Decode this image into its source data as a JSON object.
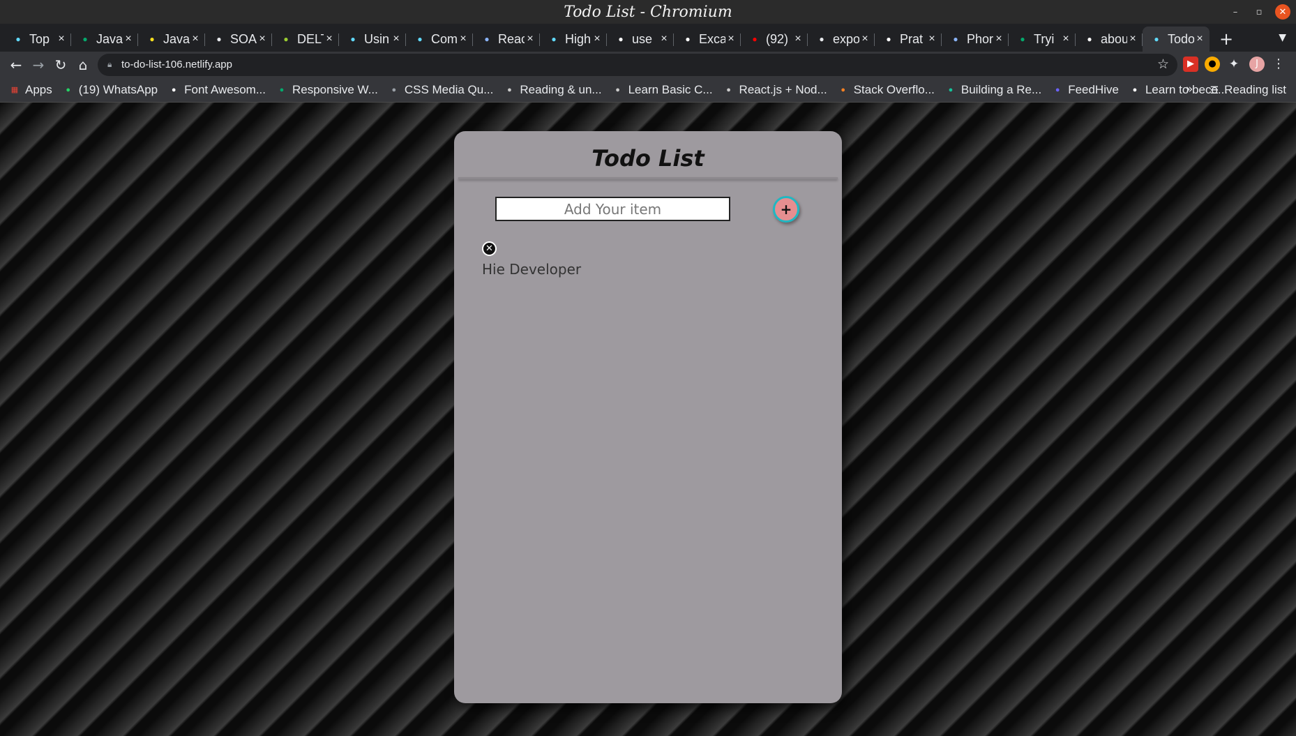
{
  "window": {
    "title": "Todo List - Chromium"
  },
  "tabs": [
    {
      "label": "Top",
      "icon": "react-icon",
      "color": "#61dafb"
    },
    {
      "label": "Java",
      "icon": "w3-icon",
      "color": "#04aa6d"
    },
    {
      "label": "Java",
      "icon": "js-icon",
      "color": "#f7df1e"
    },
    {
      "label": "SOA",
      "icon": "github-icon",
      "color": "#e8eaed"
    },
    {
      "label": "DELT",
      "icon": "refresh-icon",
      "color": "#9acd32"
    },
    {
      "label": "Usin",
      "icon": "react-icon",
      "color": "#61dafb"
    },
    {
      "label": "Com",
      "icon": "react-icon",
      "color": "#61dafb"
    },
    {
      "label": "Reac",
      "icon": "mountain-icon",
      "color": "#8ab4f8"
    },
    {
      "label": "High",
      "icon": "react-icon",
      "color": "#61dafb"
    },
    {
      "label": "use",
      "icon": "google-icon",
      "color": "#ffffff"
    },
    {
      "label": "Exca",
      "icon": "doc-icon",
      "color": "#ffffff"
    },
    {
      "label": "(92)",
      "icon": "youtube-icon",
      "color": "#ff0000"
    },
    {
      "label": "expo",
      "icon": "github-icon",
      "color": "#e8eaed"
    },
    {
      "label": "Prat",
      "icon": "bookmark-icon",
      "color": "#ffffff"
    },
    {
      "label": "Phor",
      "icon": "flag-icon",
      "color": "#8ab4f8"
    },
    {
      "label": "Tryi",
      "icon": "w3-icon",
      "color": "#04aa6d"
    },
    {
      "label": "abou",
      "icon": "globe-icon",
      "color": "#ffffff"
    },
    {
      "label": "Todo",
      "icon": "react-icon",
      "color": "#61dafb",
      "active": true
    }
  ],
  "toolbar": {
    "url": "to-do-list-106.netlify.app"
  },
  "bookmarks": [
    {
      "label": "Apps",
      "icon": "apps-grid-icon",
      "color": "#ea4335"
    },
    {
      "label": "(19) WhatsApp",
      "icon": "whatsapp-icon",
      "color": "#25d366"
    },
    {
      "label": "Font Awesom...",
      "icon": "flag-icon",
      "color": "#ffffff"
    },
    {
      "label": "Responsive W...",
      "icon": "w3-icon",
      "color": "#04aa6d"
    },
    {
      "label": "CSS Media Qu...",
      "icon": "github-icon",
      "color": "#9aa0a6"
    },
    {
      "label": "Reading & un...",
      "icon": "eye-icon",
      "color": "#cccccc"
    },
    {
      "label": "Learn Basic C...",
      "icon": "angular-icon",
      "color": "#cccccc"
    },
    {
      "label": "React.js + Nod...",
      "icon": "braces-icon",
      "color": "#cccccc"
    },
    {
      "label": "Stack Overflo...",
      "icon": "stackoverflow-icon",
      "color": "#f48024"
    },
    {
      "label": "Building a Re...",
      "icon": "grammarly-icon",
      "color": "#15c39a"
    },
    {
      "label": "FeedHive",
      "icon": "feedhive-icon",
      "color": "#6c63ff"
    },
    {
      "label": "Learn to beco...",
      "icon": "f-icon",
      "color": "#ffffff"
    }
  ],
  "reading_list": "Reading list",
  "app": {
    "title": "Todo List",
    "input_placeholder": "Add Your item",
    "input_value": "",
    "add_button": "+",
    "delete_button": "✕",
    "items": [
      "Hie Developer"
    ]
  },
  "colors": {
    "card_bg": "#9e9a9f",
    "add_button_fill": "#e58e90",
    "add_button_ring": "#1fb8c3"
  }
}
